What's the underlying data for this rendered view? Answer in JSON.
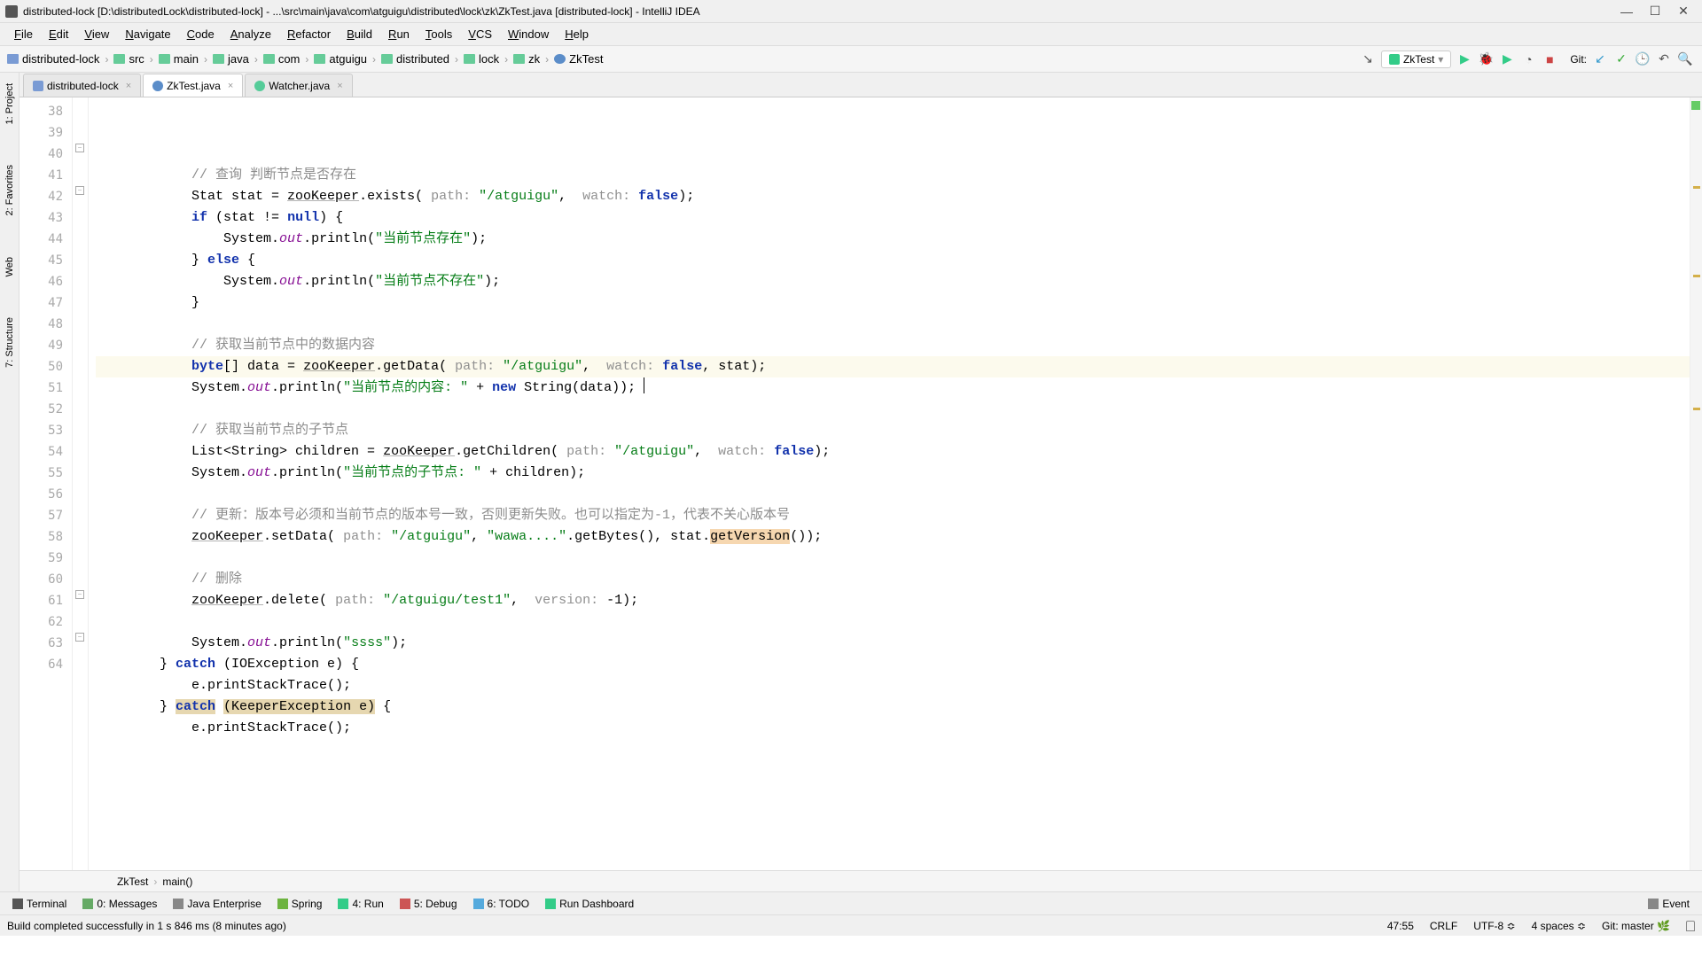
{
  "title": "distributed-lock [D:\\distributedLock\\distributed-lock] - ...\\src\\main\\java\\com\\atguigu\\distributed\\lock\\zk\\ZkTest.java [distributed-lock] - IntelliJ IDEA",
  "menu": [
    "File",
    "Edit",
    "View",
    "Navigate",
    "Code",
    "Analyze",
    "Refactor",
    "Build",
    "Run",
    "Tools",
    "VCS",
    "Window",
    "Help"
  ],
  "breadcrumbs": [
    "distributed-lock",
    "src",
    "main",
    "java",
    "com",
    "atguigu",
    "distributed",
    "lock",
    "zk",
    "ZkTest"
  ],
  "run_config": "ZkTest",
  "git_label": "Git:",
  "tabs": [
    {
      "name": "distributed-lock",
      "icon": "folder",
      "active": false
    },
    {
      "name": "ZkTest.java",
      "icon": "java",
      "active": true
    },
    {
      "name": "Watcher.java",
      "icon": "iface",
      "active": false
    }
  ],
  "left_tools": [
    "1: Project",
    "2: Favorites",
    "Web",
    "7: Structure"
  ],
  "code_lines": [
    {
      "n": 38,
      "html": "            <span class='com'>// 查询 判断节点是否存在</span>"
    },
    {
      "n": 39,
      "html": "            Stat stat = <span class='ul'>zooKeeper</span>.exists( <span class='hint'>path:</span> <span class='str'>\"/atguigu\"</span>,  <span class='hint'>watch:</span> <span class='kw'>false</span>);"
    },
    {
      "n": 40,
      "html": "            <span class='kw'>if</span> (stat != <span class='kw'>null</span>) {"
    },
    {
      "n": 41,
      "html": "                System.<span class='field'>out</span>.println(<span class='str'>\"当前节点存在\"</span>);"
    },
    {
      "n": 42,
      "html": "            } <span class='kw'>else</span> {"
    },
    {
      "n": 43,
      "html": "                System.<span class='field'>out</span>.println(<span class='str'>\"当前节点不存在\"</span>);"
    },
    {
      "n": 44,
      "html": "            }"
    },
    {
      "n": 45,
      "html": ""
    },
    {
      "n": 46,
      "html": "            <span class='com'>// 获取当前节点中的数据内容</span>"
    },
    {
      "n": 47,
      "html": "            <span class='kw'>byte</span>[] data = <span class='ul'>zooKeeper</span>.getData( <span class='hint'>path:</span> <span class='str'>\"/atguigu\"</span>,  <span class='hint'>watch:</span> <span class='kw'>false</span>, stat);",
      "current": true
    },
    {
      "n": 48,
      "html": "            System.<span class='field'>out</span>.println(<span class='str'>\"当前节点的内容: \"</span> + <span class='kw'>new</span> String(data));"
    },
    {
      "n": 49,
      "html": ""
    },
    {
      "n": 50,
      "html": "            <span class='com'>// 获取当前节点的子节点</span>"
    },
    {
      "n": 51,
      "html": "            List&lt;String&gt; children = <span class='ul'>zooKeeper</span>.getChildren( <span class='hint'>path:</span> <span class='str'>\"/atguigu\"</span>,  <span class='hint'>watch:</span> <span class='kw'>false</span>);"
    },
    {
      "n": 52,
      "html": "            System.<span class='field'>out</span>.println(<span class='str'>\"当前节点的子节点: \"</span> + children);"
    },
    {
      "n": 53,
      "html": ""
    },
    {
      "n": 54,
      "html": "            <span class='com'>// 更新：版本号必须和当前节点的版本号一致，否则更新失败。也可以指定为-1，代表不关心版本号</span>"
    },
    {
      "n": 55,
      "html": "            <span class='ul'>zooKeeper</span>.setData( <span class='hint'>path:</span> <span class='str'>\"/atguigu\"</span>, <span class='str'>\"wawa....\"</span>.getBytes(), stat.<span style='background:#f6d7b0'>getVersion</span>());"
    },
    {
      "n": 56,
      "html": ""
    },
    {
      "n": 57,
      "html": "            <span class='com'>// 删除</span>"
    },
    {
      "n": 58,
      "html": "            <span class='ul'>zooKeeper</span>.delete( <span class='hint'>path:</span> <span class='str'>\"/atguigu/test1\"</span>,  <span class='hint'>version:</span> -1);"
    },
    {
      "n": 59,
      "html": ""
    },
    {
      "n": 60,
      "html": "            System.<span class='field'>out</span>.println(<span class='str'>\"ssss\"</span>);"
    },
    {
      "n": 61,
      "html": "        } <span class='kw'>catch</span> (IOException e) {"
    },
    {
      "n": 62,
      "html": "            e.printStackTrace();"
    },
    {
      "n": 63,
      "html": "        } <span class='kw' style='background:#e6d7b0'>catch</span> <span style='background:#e6d7b0'>(KeeperException e)</span> {"
    },
    {
      "n": 64,
      "html": "            e.printStackTrace();"
    }
  ],
  "bottom_breadcrumb": [
    "ZkTest",
    "main()"
  ],
  "bottom_tools": [
    {
      "label": "Terminal",
      "icon": "term"
    },
    {
      "label": "0: Messages",
      "icon": "msg"
    },
    {
      "label": "Java Enterprise",
      "icon": "je"
    },
    {
      "label": "Spring",
      "icon": "spring"
    },
    {
      "label": "4: Run",
      "icon": "run"
    },
    {
      "label": "5: Debug",
      "icon": "debug"
    },
    {
      "label": "6: TODO",
      "icon": "todo"
    },
    {
      "label": "Run Dashboard",
      "icon": "dash"
    }
  ],
  "event_log": "Event",
  "status_msg": "Build completed successfully in 1 s 846 ms (8 minutes ago)",
  "status_right": {
    "pos": "47:55",
    "sep": "CRLF",
    "enc": "UTF-8",
    "indent": "4 spaces",
    "git": "Git: master"
  }
}
